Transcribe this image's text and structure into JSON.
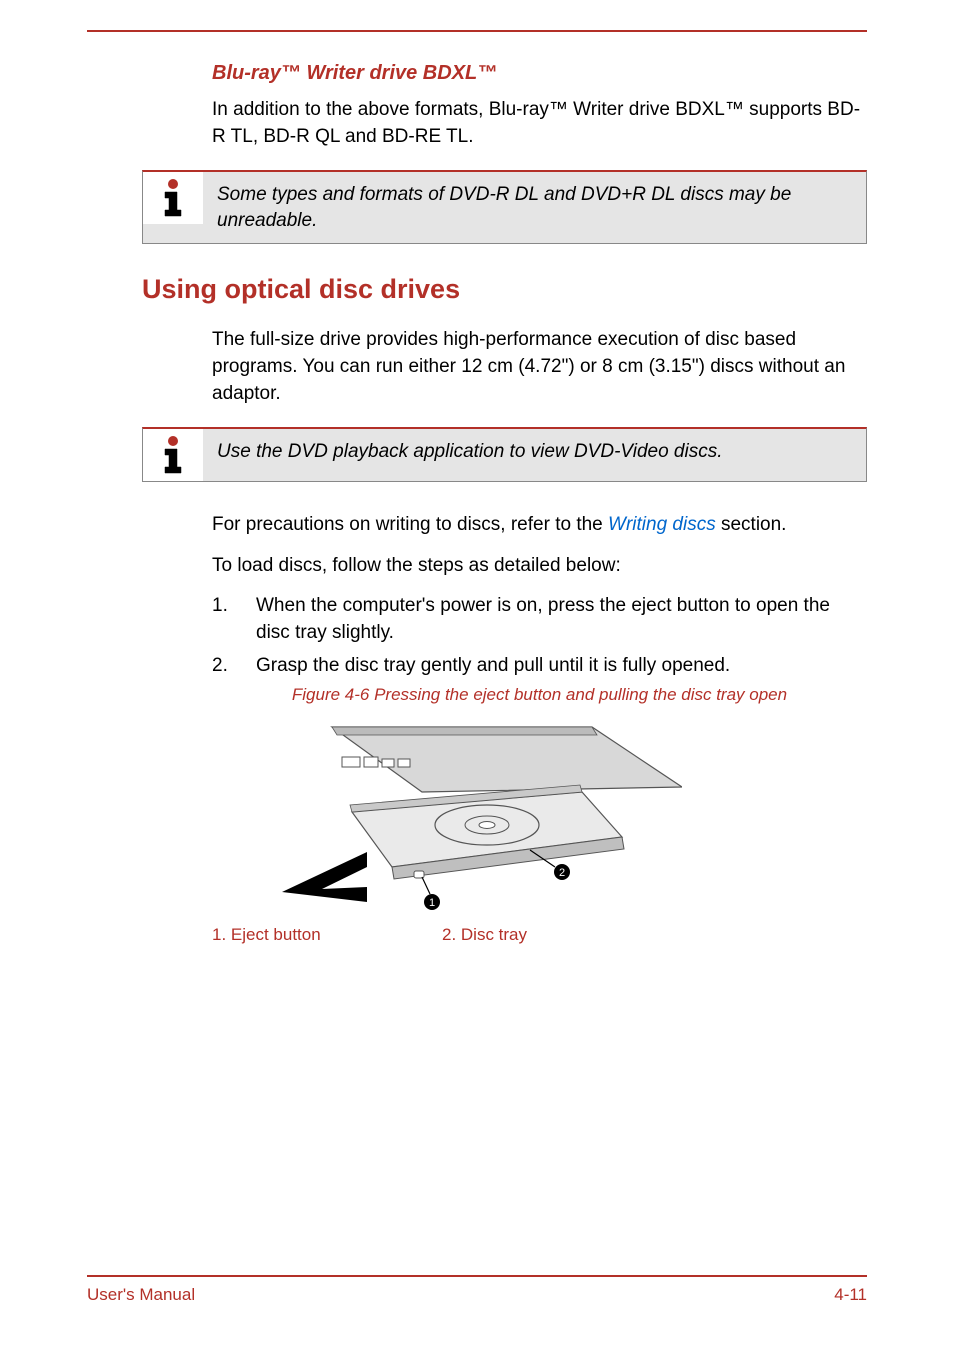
{
  "subheading": "Blu-ray™ Writer drive BDXL™",
  "para1": "In addition to the above formats, Blu-ray™ Writer drive BDXL™ supports BD-R TL, BD-R QL and BD-RE TL.",
  "note1": "Some types and formats of DVD-R DL and DVD+R DL discs may be unreadable.",
  "sectionHeading": "Using optical disc drives",
  "para2": "The full-size drive provides high-performance execution of disc based programs. You can run either 12 cm (4.72\") or 8 cm (3.15\") discs without an adaptor.",
  "note2": "Use the DVD playback application to view DVD-Video discs.",
  "para3a": "For precautions on writing to discs, refer to the ",
  "linkText": "Writing discs",
  "para3b": " section.",
  "para4": "To load discs, follow the steps as detailed below:",
  "steps": [
    {
      "n": "1.",
      "text": "When the computer's power is on, press the eject button to open the disc tray slightly."
    },
    {
      "n": "2.",
      "text": "Grasp the disc tray gently and pull until it is fully opened."
    }
  ],
  "figureCaption": "Figure 4-6 Pressing the eject button and pulling the disc tray open",
  "legend1": "1. Eject button",
  "legend2": "2. Disc tray",
  "footerLeft": "User's Manual",
  "footerRight": "4-11"
}
